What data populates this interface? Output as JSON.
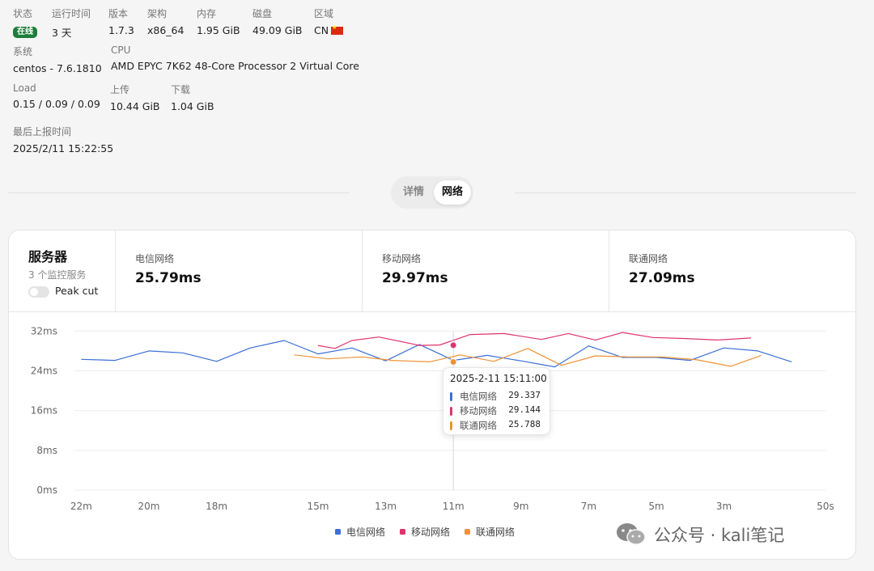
{
  "info": {
    "status": {
      "label": "状态",
      "value": "在线"
    },
    "uptime": {
      "label": "运行时间",
      "value": "3 天"
    },
    "version": {
      "label": "版本",
      "value": "1.7.3"
    },
    "arch": {
      "label": "架构",
      "value": "x86_64"
    },
    "memory": {
      "label": "内存",
      "value": "1.95 GiB"
    },
    "disk": {
      "label": "磁盘",
      "value": "49.09 GiB"
    },
    "region": {
      "label": "区域",
      "value": "CN"
    },
    "system": {
      "label": "系统",
      "value": "centos - 7.6.1810"
    },
    "cpu": {
      "label": "CPU",
      "value": "AMD EPYC 7K62 48-Core Processor 2 Virtual Core"
    },
    "load": {
      "label": "Load",
      "value": "0.15 / 0.09 / 0.09"
    },
    "upload": {
      "label": "上传",
      "value": "10.44 GiB"
    },
    "download": {
      "label": "下载",
      "value": "1.04 GiB"
    },
    "last_report": {
      "label": "最后上报时间",
      "value": "2025/2/11 15:22:55"
    }
  },
  "tabs": {
    "details": "详情",
    "network": "网络",
    "active": "network"
  },
  "server_card": {
    "title": "服务器",
    "subtitle": "3 个监控服务",
    "peak_cut_label": "Peak cut",
    "peak_cut_enabled": false,
    "metrics": [
      {
        "name": "电信网络",
        "value": "25.79ms"
      },
      {
        "name": "移动网络",
        "value": "29.97ms"
      },
      {
        "name": "联通网络",
        "value": "27.09ms"
      }
    ]
  },
  "tooltip": {
    "title": "2025-2-11 15:11:00",
    "rows": [
      {
        "name": "电信网络",
        "value": "29.337"
      },
      {
        "name": "移动网络",
        "value": "29.144"
      },
      {
        "name": "联通网络",
        "value": "25.788"
      }
    ]
  },
  "watermark": {
    "text": "公众号 · kali笔记",
    "icon": "wechat-icon"
  },
  "colors": {
    "telecom": "#3a6fd8",
    "mobile": "#e0336d",
    "unicom": "#ee9233",
    "online": "#1e7d3a"
  },
  "chart_data": {
    "type": "line",
    "x_unit": "minutes ago",
    "xlim": [
      22.2,
      0
    ],
    "ylim": [
      0,
      34
    ],
    "y_ticks": [
      0,
      8,
      16,
      24,
      32
    ],
    "y_tick_labels": [
      "0ms",
      "8ms",
      "16ms",
      "24ms",
      "32ms"
    ],
    "x_ticks": [
      22,
      20,
      18,
      15,
      13,
      11,
      9,
      7,
      5,
      3,
      0
    ],
    "x_tick_labels": [
      "22m",
      "20m",
      "18m",
      "15m",
      "13m",
      "11m",
      "9m",
      "7m",
      "5m",
      "3m",
      "50s"
    ],
    "grid": true,
    "legend_position": "bottom-center",
    "crosshair_x": 11,
    "series": [
      {
        "name": "电信网络",
        "color": "#3a6fd8",
        "points": [
          [
            22,
            26.3
          ],
          [
            21,
            26.1
          ],
          [
            20,
            28
          ],
          [
            19,
            27.6
          ],
          [
            18,
            25.9
          ],
          [
            17,
            28.6
          ],
          [
            16,
            30.1
          ],
          [
            15,
            27.4
          ],
          [
            14,
            28.6
          ],
          [
            13,
            26
          ],
          [
            12,
            29.3
          ],
          [
            11,
            26.1
          ],
          [
            10,
            27.1
          ],
          [
            9,
            26
          ],
          [
            8,
            24.8
          ],
          [
            7,
            29
          ],
          [
            6,
            26.7
          ],
          [
            5,
            26.7
          ],
          [
            4,
            26.1
          ],
          [
            3,
            28.6
          ],
          [
            2,
            28
          ],
          [
            1,
            25.8
          ]
        ]
      },
      {
        "name": "移动网络",
        "color": "#e0336d",
        "points": [
          [
            15,
            29.1
          ],
          [
            14.5,
            28.5
          ],
          [
            14,
            30.1
          ],
          [
            13.2,
            30.8
          ],
          [
            12,
            29.1
          ],
          [
            11.4,
            29.2
          ],
          [
            10.5,
            31.3
          ],
          [
            9.5,
            31.5
          ],
          [
            8.4,
            30.3
          ],
          [
            7.6,
            31.5
          ],
          [
            6.8,
            30.2
          ],
          [
            6,
            31.7
          ],
          [
            5.1,
            30.7
          ],
          [
            4.2,
            30.5
          ],
          [
            3.2,
            30.2
          ],
          [
            2.2,
            30.6
          ]
        ]
      },
      {
        "name": "联通网络",
        "color": "#ee9233",
        "points": [
          [
            15.7,
            27.2
          ],
          [
            14.7,
            26.4
          ],
          [
            13.7,
            26.8
          ],
          [
            12.8,
            26.1
          ],
          [
            11.7,
            25.8
          ],
          [
            10.8,
            27.2
          ],
          [
            9.8,
            25.9
          ],
          [
            8.8,
            28.5
          ],
          [
            7.8,
            25.1
          ],
          [
            6.8,
            27
          ],
          [
            5.8,
            26.8
          ],
          [
            4.8,
            26.8
          ],
          [
            3.8,
            26.2
          ],
          [
            2.8,
            24.9
          ],
          [
            1.9,
            27.1
          ]
        ]
      }
    ]
  }
}
